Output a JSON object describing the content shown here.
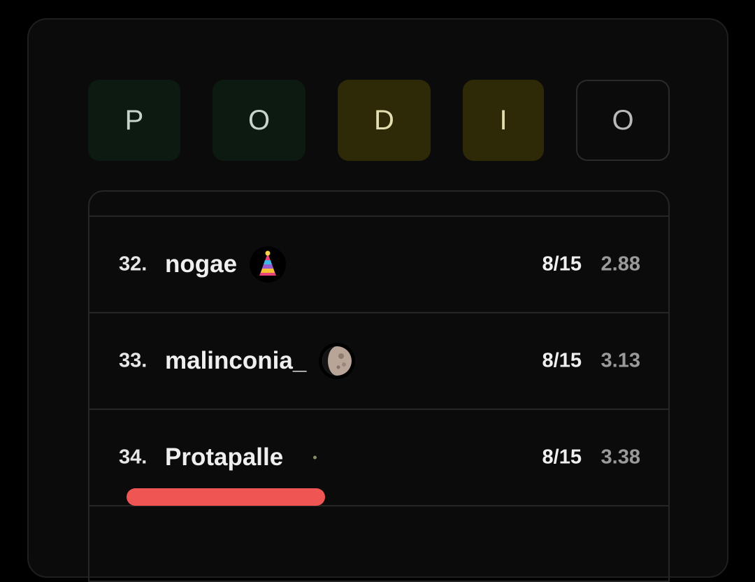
{
  "tiles": [
    {
      "letter": "P",
      "state": "green"
    },
    {
      "letter": "O",
      "state": "green"
    },
    {
      "letter": "D",
      "state": "yellow"
    },
    {
      "letter": "I",
      "state": "yellow"
    },
    {
      "letter": "O",
      "state": "empty"
    }
  ],
  "colors": {
    "tile_green": "#0c1a12",
    "tile_yellow": "#2e2a08",
    "highlight": "#ef5552"
  },
  "leaderboard": {
    "rows": [
      {
        "rank": "32.",
        "name": "nogae",
        "badge": "party-hat-icon",
        "score": "8/15",
        "avg": "2.88"
      },
      {
        "rank": "33.",
        "name": "malinconia_",
        "badge": "moon-icon",
        "score": "8/15",
        "avg": "3.13"
      },
      {
        "rank": "34.",
        "name": "Protapalle",
        "badge": "dot-icon",
        "score": "8/15",
        "avg": "3.38"
      }
    ]
  }
}
